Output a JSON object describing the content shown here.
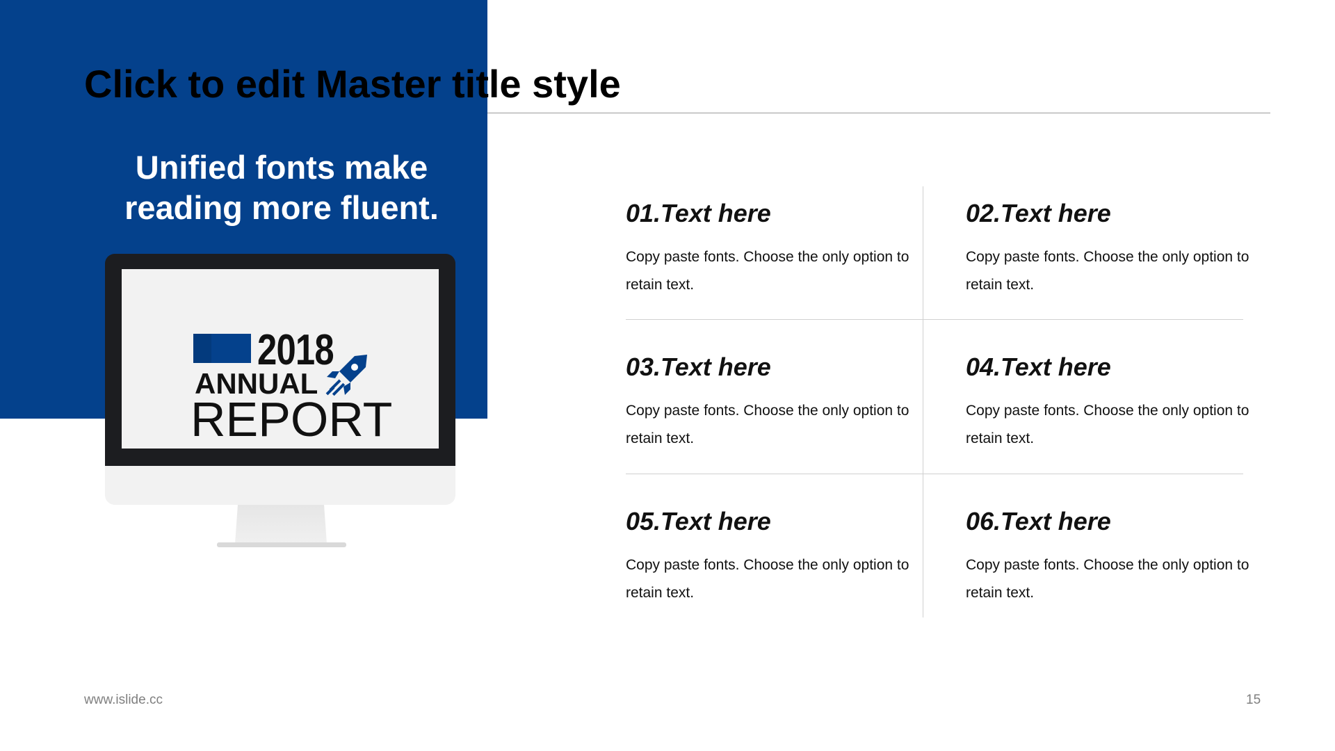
{
  "slide": {
    "title": "Click to edit Master title style",
    "tagline": "Unified fonts make reading more fluent.",
    "accent_color": "#04418c"
  },
  "monitor": {
    "year": "2018",
    "annual": "ANNUAL",
    "report": "REPORT",
    "icon": "rocket-icon"
  },
  "items": [
    {
      "title": "01.Text here",
      "desc": "Copy paste fonts. Choose the only option to retain text."
    },
    {
      "title": "02.Text here",
      "desc": "Copy paste fonts. Choose the only option to retain text."
    },
    {
      "title": "03.Text here",
      "desc": "Copy paste fonts. Choose the only option to retain text."
    },
    {
      "title": "04.Text here",
      "desc": "Copy paste fonts. Choose the only option to retain text."
    },
    {
      "title": "05.Text here",
      "desc": "Copy paste fonts. Choose the only option to retain text."
    },
    {
      "title": "06.Text here",
      "desc": "Copy paste fonts. Choose the only option to retain text."
    }
  ],
  "footer": {
    "url": "www.islide.cc",
    "page_number": "15"
  }
}
